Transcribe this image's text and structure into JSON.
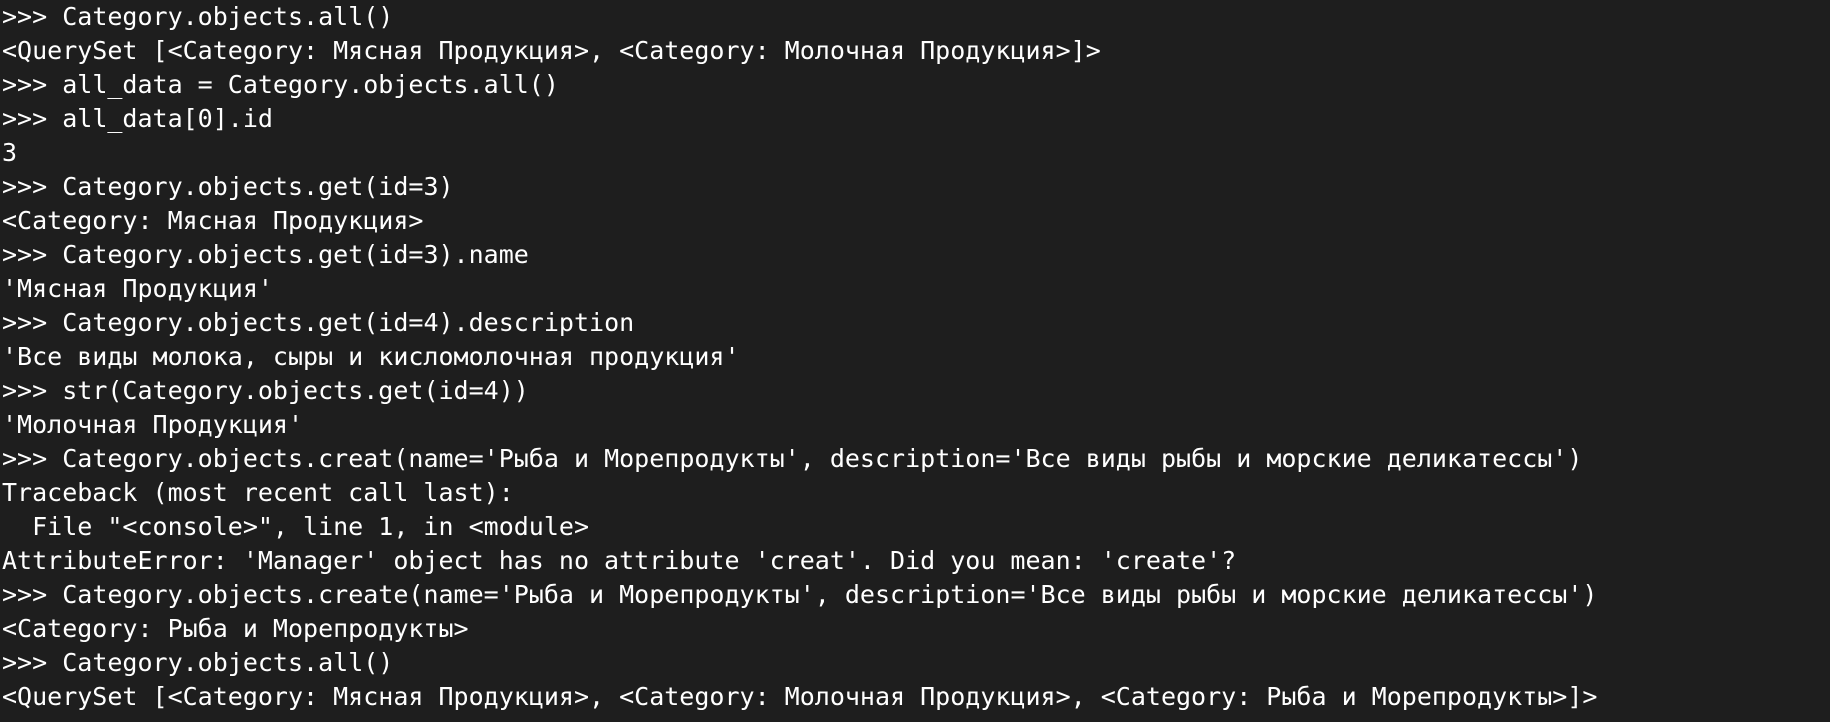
{
  "terminal": {
    "prompt": ">>> ",
    "lines": [
      {
        "type": "input",
        "text": "Category.objects.all()"
      },
      {
        "type": "output",
        "text": "<QuerySet [<Category: Мясная Продукция>, <Category: Молочная Продукция>]>"
      },
      {
        "type": "input",
        "text": "all_data = Category.objects.all()"
      },
      {
        "type": "input",
        "text": "all_data[0].id"
      },
      {
        "type": "output",
        "text": "3"
      },
      {
        "type": "input",
        "text": "Category.objects.get(id=3)"
      },
      {
        "type": "output",
        "text": "<Category: Мясная Продукция>"
      },
      {
        "type": "input",
        "text": "Category.objects.get(id=3).name"
      },
      {
        "type": "output",
        "text": "'Мясная Продукция'"
      },
      {
        "type": "input",
        "text": "Category.objects.get(id=4).description"
      },
      {
        "type": "output",
        "text": "'Все виды молока, сыры и кисломолочная продукция'"
      },
      {
        "type": "input",
        "text": "str(Category.objects.get(id=4))"
      },
      {
        "type": "output",
        "text": "'Молочная Продукция'"
      },
      {
        "type": "input",
        "text": "Category.objects.creat(name='Рыба и Морепродукты', description='Все виды рыбы и морские деликатессы')"
      },
      {
        "type": "output",
        "text": "Traceback (most recent call last):"
      },
      {
        "type": "output",
        "text": "  File \"<console>\", line 1, in <module>"
      },
      {
        "type": "output",
        "text": "AttributeError: 'Manager' object has no attribute 'creat'. Did you mean: 'create'?"
      },
      {
        "type": "input",
        "text": "Category.objects.create(name='Рыба и Морепродукты', description='Все виды рыбы и морские деликатессы')"
      },
      {
        "type": "output",
        "text": "<Category: Рыба и Морепродукты>"
      },
      {
        "type": "input",
        "text": "Category.objects.all()"
      },
      {
        "type": "output",
        "text": "<QuerySet [<Category: Мясная Продукция>, <Category: Молочная Продукция>, <Category: Рыба и Морепродукты>]>"
      }
    ]
  },
  "colors": {
    "background": "#1e1e1e",
    "text": "#ffffff"
  }
}
